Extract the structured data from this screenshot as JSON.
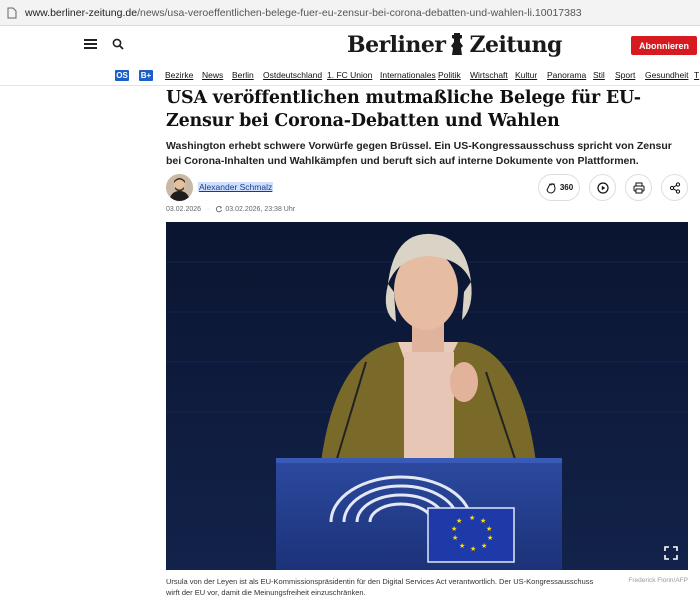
{
  "browser": {
    "url_host": "www.berliner-zeitung.de",
    "url_path": "/news/usa-veroeffentlichen-belege-fuer-eu-zensur-bei-corona-debatten-und-wahlen-li.10017383"
  },
  "header": {
    "logo_word1": "Berliner",
    "logo_word2": "Zeitung",
    "subscribe_label": "Abonnieren"
  },
  "nav": {
    "badge_os": "OS",
    "badge_bplus": "B+",
    "items": [
      "Bezirke",
      "News",
      "Berlin",
      "Ostdeutschland",
      "1. FC Union",
      "Internationales",
      "Politik",
      "Wirtschaft",
      "Kultur",
      "Panorama",
      "Stil",
      "Sport",
      "Gesundheit",
      "T"
    ]
  },
  "article": {
    "headline": "USA veröffentlichen mutmaßliche Belege für EU-Zensur bei Corona-Debatten und Wahlen",
    "lead": "Washington erhebt schwere Vorwürfe gegen Brüssel. Ein US-Kongressausschuss spricht von Zensur bei Corona-Inhalten und Wahlkämpfen und beruft sich auf interne Dokumente von Plattformen.",
    "author": "Alexander Schmalz",
    "published": "03.02.2026",
    "updated": "03.02.2026, 23:38 Uhr",
    "clap_count": "360",
    "caption": "Ursula von der Leyen ist als EU-Kommissionspräsidentin für den Digital Services Act verantwortlich. Der US-Kongressausschuss wirft der EU vor, damit die Meinungsfreiheit einzuschränken.",
    "credit": "Frederick Florin/AFP"
  },
  "colors": {
    "accent_red": "#d71920",
    "badge_blue": "#1d5fc6",
    "photo_bg": "#0b1633"
  }
}
